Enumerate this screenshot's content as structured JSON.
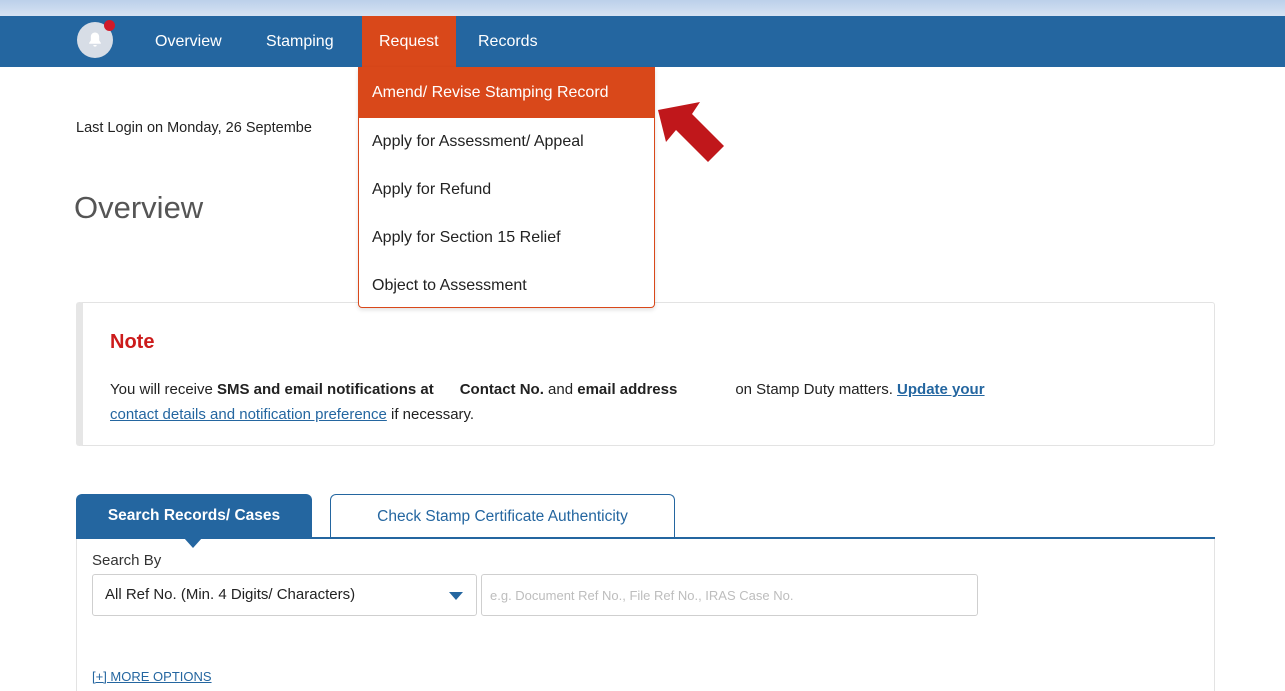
{
  "nav": {
    "items": [
      {
        "label": "Overview"
      },
      {
        "label": "Stamping"
      },
      {
        "label": "Request"
      },
      {
        "label": "Records"
      }
    ],
    "active": "Request"
  },
  "request_menu": {
    "items": [
      {
        "label": "Amend/ Revise Stamping Record"
      },
      {
        "label": "Apply for Assessment/ Appeal"
      },
      {
        "label": "Apply for Refund"
      },
      {
        "label": "Apply for Section 15 Relief"
      },
      {
        "label": "Object to Assessment"
      }
    ],
    "highlighted": "Amend/ Revise Stamping Record"
  },
  "last_login": "Last Login on Monday, 26 Septembe",
  "page_title": "Overview",
  "note": {
    "title": "Note",
    "text_1": "You will receive ",
    "bold_1": "SMS and email notifications at",
    "bold_2": "Contact No.",
    "text_2": " and ",
    "bold_3": "email address",
    "text_3": "on Stamp Duty matters. ",
    "link_1": "Update your",
    "link_2": "contact details and notification preference",
    "text_4": " if necessary."
  },
  "tabs": {
    "active": "Search Records/ Cases",
    "inactive": "Check Stamp Certificate Authenticity"
  },
  "search": {
    "search_by_label": "Search By",
    "selected_option": "All Ref No. (Min. 4 Digits/ Characters)",
    "placeholder": "e.g. Document Ref No., File Ref No., IRAS Case No.",
    "more_options": "[+] MORE OPTIONS"
  },
  "colors": {
    "nav_blue": "#2466a0",
    "active_orange": "#d9481a",
    "note_red": "#cc1b1b",
    "arrow_red": "#c0171b"
  },
  "icons": [
    "bell-icon",
    "notification-dot",
    "pointer-arrow-icon",
    "caret-down-icon"
  ]
}
